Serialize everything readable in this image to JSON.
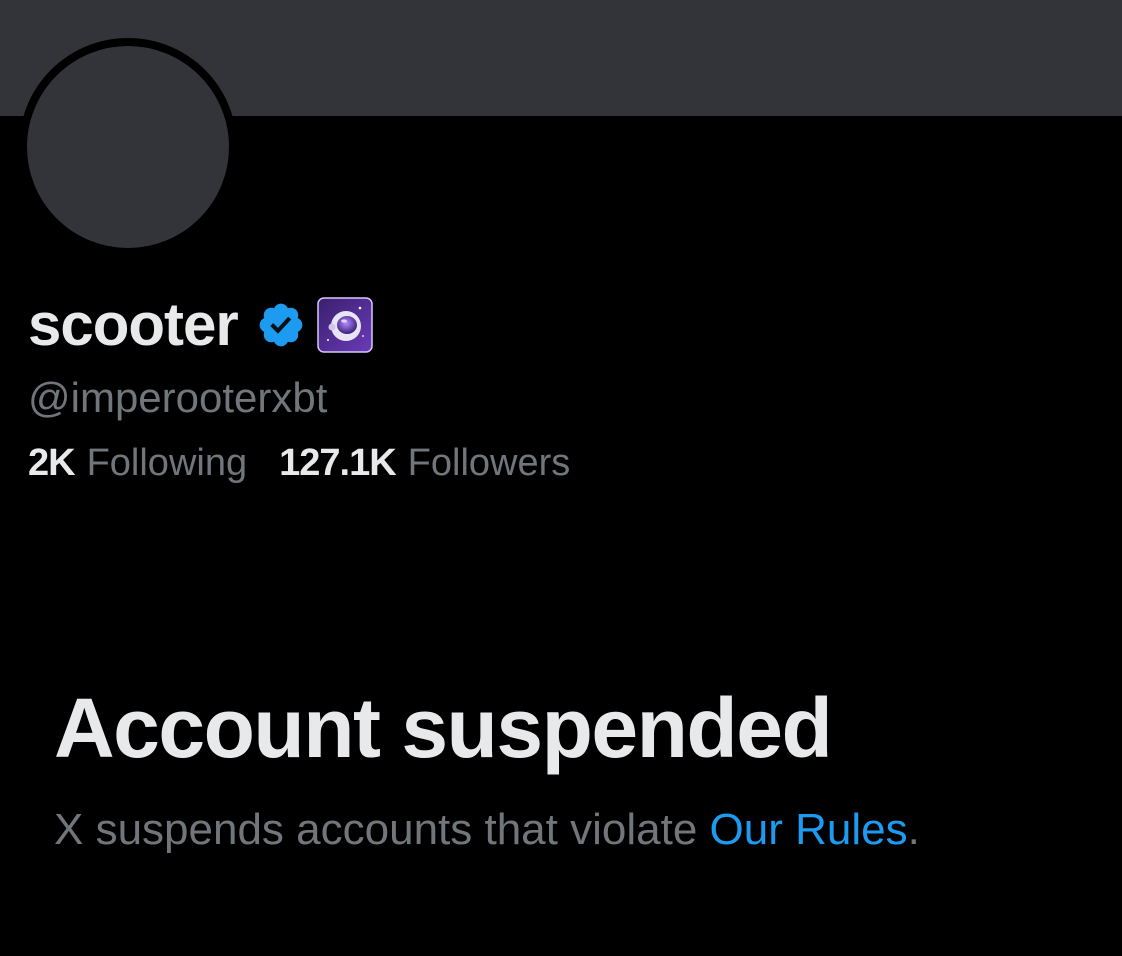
{
  "profile": {
    "display_name": "scooter",
    "handle": "@imperooterxbt",
    "verified_icon": "verified-badge-icon",
    "affiliate_icon": "astronaut-helmet-icon"
  },
  "stats": {
    "following_count": "2K",
    "following_label": "Following",
    "followers_count": "127.1K",
    "followers_label": "Followers"
  },
  "suspension": {
    "title": "Account suspended",
    "description_prefix": "X suspends accounts that violate ",
    "rules_link": "Our Rules",
    "description_suffix": "."
  },
  "colors": {
    "background": "#000000",
    "banner": "#333439",
    "primary_text": "#e7e9ea",
    "secondary_text": "#71767b",
    "link": "#1d9bf0",
    "verified": "#1d9bf0"
  }
}
